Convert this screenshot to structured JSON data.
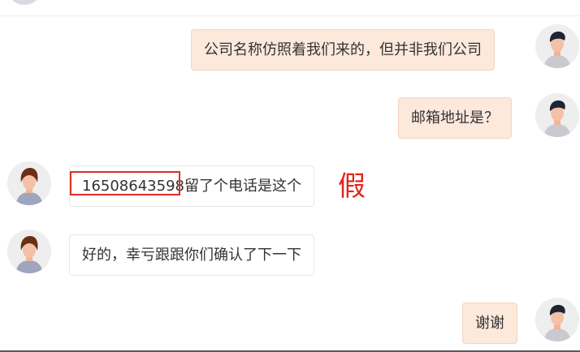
{
  "messages": [
    {
      "side": "out",
      "text": "公司名称仿照着我们来的，但并非我们公司"
    },
    {
      "side": "out",
      "text": "邮箱地址是？"
    },
    {
      "side": "in",
      "phone": "16508643598",
      "text": "留了个电话是这个"
    },
    {
      "side": "in",
      "text": "好的，幸亏跟跟你们确认了下一下"
    },
    {
      "side": "out",
      "text": "谢谢"
    }
  ],
  "annotation": {
    "text": "假",
    "color": "#e0251a"
  },
  "colors": {
    "outgoing_bubble": "#fde8dc",
    "incoming_bubble": "#ffffff",
    "highlight_box": "#d93025"
  },
  "icons": {
    "self_avatar": "male-avatar-icon",
    "other_avatar": "female-avatar-icon"
  }
}
